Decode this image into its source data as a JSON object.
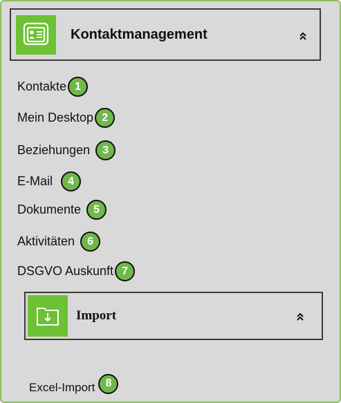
{
  "section": {
    "title": "Kontaktmanagement",
    "icon": "contact-card-icon",
    "collapse_icon": "double-chevron-up-icon"
  },
  "nav_items": [
    {
      "label": "Kontakte",
      "badge": "1"
    },
    {
      "label": "Mein Desktop",
      "badge": "2"
    },
    {
      "label": "Beziehungen",
      "badge": "3"
    },
    {
      "label": "E-Mail",
      "badge": "4"
    },
    {
      "label": "Dokumente",
      "badge": "5"
    },
    {
      "label": "Aktivitäten",
      "badge": "6"
    },
    {
      "label": "DSGVO Auskunft",
      "badge": "7"
    }
  ],
  "subsection": {
    "title": "Import",
    "icon": "folder-import-icon",
    "collapse_icon": "double-chevron-up-icon",
    "items": [
      {
        "label": "Excel-Import",
        "badge": "8"
      }
    ]
  },
  "colors": {
    "accent_green": "#6cc134",
    "badge_green": "#70b84b",
    "frame_border": "#8cbf5a",
    "panel_bg": "#d9d9d9"
  }
}
